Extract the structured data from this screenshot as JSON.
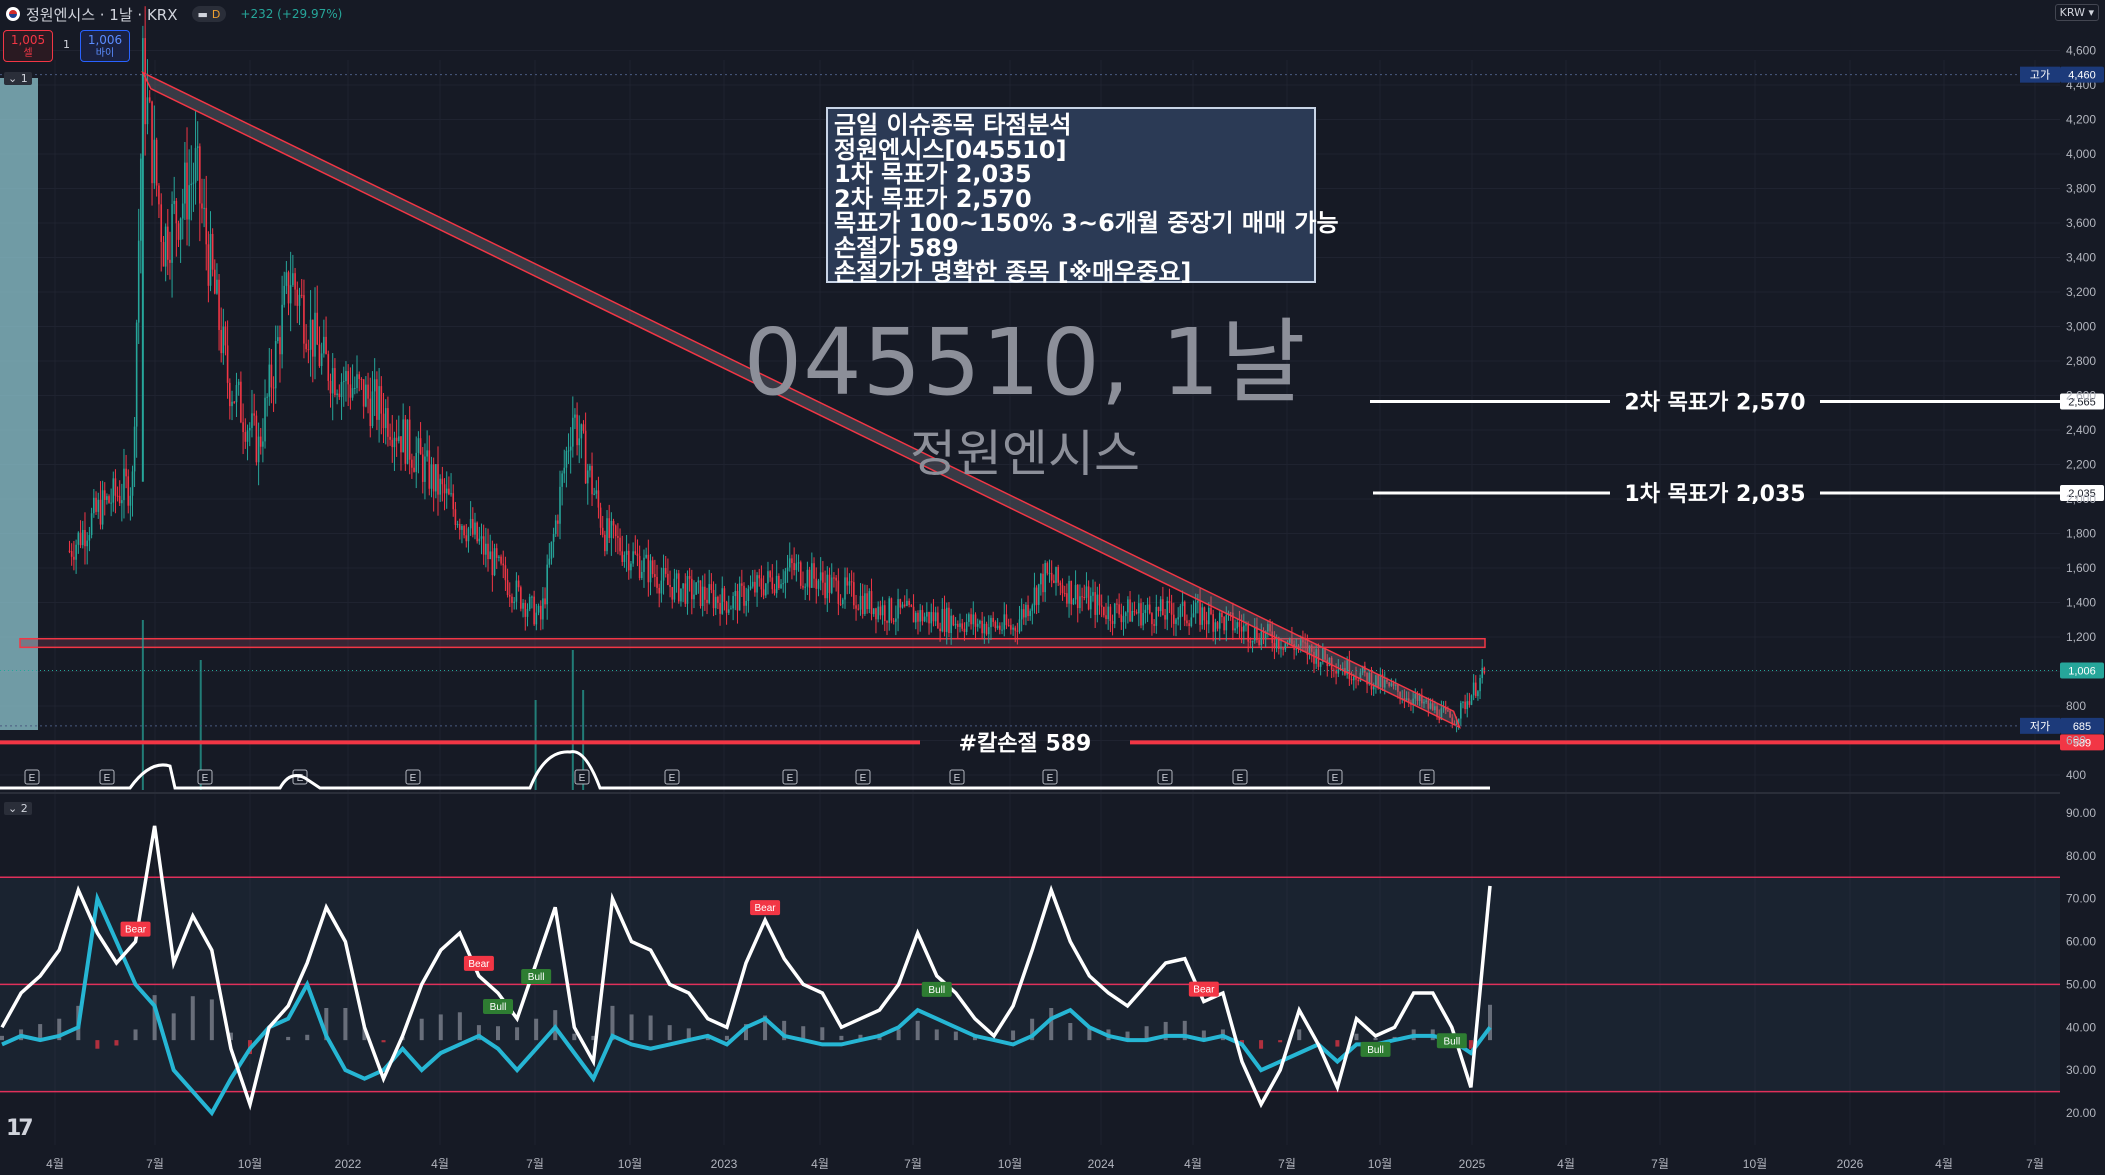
{
  "header": {
    "symbol_title": "정원엔시스 · 1날 · KRX",
    "interval_badge": "D",
    "change_text": "+232 (+29.97%)",
    "currency": "KRW"
  },
  "trade": {
    "sell_price": "1,005",
    "sell_label": "셀",
    "quantity": "1",
    "buy_price": "1,006",
    "buy_label": "바이"
  },
  "panes": {
    "main_label": "1",
    "osc_label": "2"
  },
  "watermark": {
    "line1": "045510, 1날",
    "line2": "정원엔시스"
  },
  "note_box": {
    "lines": [
      "금일 이슈종목 타점분석",
      "정원엔시스[045510]",
      "1차 목표가 2,035",
      "2차 목표가 2,570",
      "목표가 100~150% 3~6개월 중장기 매매 가능",
      "손절가 589",
      "손절가가 명확한 종목 [※매우중요]"
    ]
  },
  "levels": [
    {
      "label": "2차 목표가 2,570",
      "price": 2565,
      "axis_text": "2,565",
      "color": "#ffffff"
    },
    {
      "label": "1차 목표가 2,035",
      "price": 2035,
      "axis_text": "2,035",
      "color": "#ffffff"
    },
    {
      "label": "#칼손절 589",
      "price": 589,
      "axis_text": "589",
      "color": "#f23645"
    }
  ],
  "price_tags": {
    "high_label": "고가",
    "high_value": "4,460",
    "low_label": "저가",
    "low_value": "685",
    "last_value": "1,006"
  },
  "earnings_marker": "E",
  "signal_labels": {
    "bear": "Bear",
    "bull": "Bull"
  },
  "colors": {
    "background": "#161a25",
    "up": "#26a69a",
    "down": "#f23645",
    "rsi_line": "#ffffff",
    "signal_line": "#26b6d4",
    "band_line": "#e0305a"
  },
  "chart_data": [
    {
      "type": "candlestick",
      "title": "045510, 1날",
      "subtitle": "정원엔시스",
      "ylim": [
        400,
        4700
      ],
      "y_ticks": [
        "4,600",
        "4,400",
        "4,200",
        "4,000",
        "3,800",
        "3,600",
        "3,400",
        "3,200",
        "3,000",
        "2,800",
        "2,600",
        "2,400",
        "2,200",
        "2,000",
        "1,800",
        "1,600",
        "1,400",
        "1,200",
        "1,000",
        "800",
        "600",
        "400"
      ],
      "x_ticks": [
        "4월",
        "7월",
        "10월",
        "2022",
        "4월",
        "7월",
        "10월",
        "2023",
        "4월",
        "7월",
        "10월",
        "2024",
        "4월",
        "7월",
        "10월",
        "2025",
        "4월",
        "7월",
        "10월",
        "2026",
        "4월",
        "7월"
      ],
      "close_series": [
        {
          "date": "2021-04",
          "close": 1700
        },
        {
          "date": "2021-05",
          "close": 1950
        },
        {
          "date": "2021-06",
          "close": 2100
        },
        {
          "date": "2021-06-25",
          "close": 4460
        },
        {
          "date": "2021-07",
          "close": 3500
        },
        {
          "date": "2021-08",
          "close": 3900
        },
        {
          "date": "2021-09",
          "close": 2700
        },
        {
          "date": "2021-10",
          "close": 2300
        },
        {
          "date": "2021-11",
          "close": 3300
        },
        {
          "date": "2021-12",
          "close": 2800
        },
        {
          "date": "2022-02",
          "close": 2500
        },
        {
          "date": "2022-04",
          "close": 2000
        },
        {
          "date": "2022-06",
          "close": 1500
        },
        {
          "date": "2022-07",
          "close": 1300
        },
        {
          "date": "2022-08",
          "close": 2500
        },
        {
          "date": "2022-09",
          "close": 1800
        },
        {
          "date": "2022-11",
          "close": 1500
        },
        {
          "date": "2023-01",
          "close": 1400
        },
        {
          "date": "2023-03",
          "close": 1600
        },
        {
          "date": "2023-06",
          "close": 1350
        },
        {
          "date": "2023-10",
          "close": 1250
        },
        {
          "date": "2023-11",
          "close": 1550
        },
        {
          "date": "2024-01",
          "close": 1350
        },
        {
          "date": "2024-04",
          "close": 1330
        },
        {
          "date": "2024-07",
          "close": 1150
        },
        {
          "date": "2024-10",
          "close": 900
        },
        {
          "date": "2024-12",
          "close": 720
        },
        {
          "date": "2025-01",
          "close": 1006
        }
      ],
      "high": 4460,
      "low": 685,
      "last": 1006,
      "trendline": {
        "from": {
          "date": "2021-06-25",
          "price": 4460
        },
        "to": {
          "date": "2024-12-20",
          "price": 700
        }
      },
      "support_zone": {
        "price_top": 1190,
        "price_bottom": 1140
      }
    },
    {
      "type": "line",
      "ylim": [
        15,
        95
      ],
      "y_ticks": [
        "90.00",
        "80.00",
        "70.00",
        "60.00",
        "50.00",
        "40.00",
        "30.00",
        "20.00"
      ],
      "bands": [
        75,
        50,
        25
      ],
      "series": [
        {
          "values": [
            40,
            48,
            52,
            58,
            72,
            62,
            55,
            60,
            87,
            55,
            66,
            58,
            35,
            22,
            40,
            45,
            55,
            68,
            60,
            40,
            28,
            38,
            50,
            58,
            62,
            52,
            48,
            42,
            55,
            68,
            40,
            32,
            70,
            60,
            58,
            50,
            48,
            42,
            40,
            55,
            65,
            56,
            50,
            48,
            40,
            42,
            44,
            50,
            62,
            52,
            48,
            42,
            38,
            45,
            58,
            72,
            60,
            52,
            48,
            45,
            50,
            55,
            56,
            46,
            48,
            32,
            22,
            30,
            44,
            36,
            26,
            42,
            38,
            40,
            48,
            48,
            40,
            26,
            73
          ]
        },
        {
          "values": [
            36,
            38,
            37,
            38,
            40,
            70,
            60,
            50,
            45,
            30,
            25,
            20,
            28,
            35,
            40,
            42,
            50,
            38,
            30,
            28,
            30,
            35,
            30,
            34,
            36,
            38,
            35,
            30,
            35,
            40,
            34,
            28,
            38,
            36,
            35,
            36,
            37,
            38,
            36,
            40,
            42,
            38,
            37,
            36,
            36,
            37,
            38,
            40,
            44,
            42,
            40,
            38,
            37,
            36,
            38,
            42,
            44,
            40,
            38,
            37,
            37,
            38,
            38,
            37,
            38,
            36,
            30,
            32,
            34,
            36,
            32,
            36,
            36,
            37,
            38,
            38,
            37,
            34,
            40
          ]
        }
      ]
    }
  ]
}
